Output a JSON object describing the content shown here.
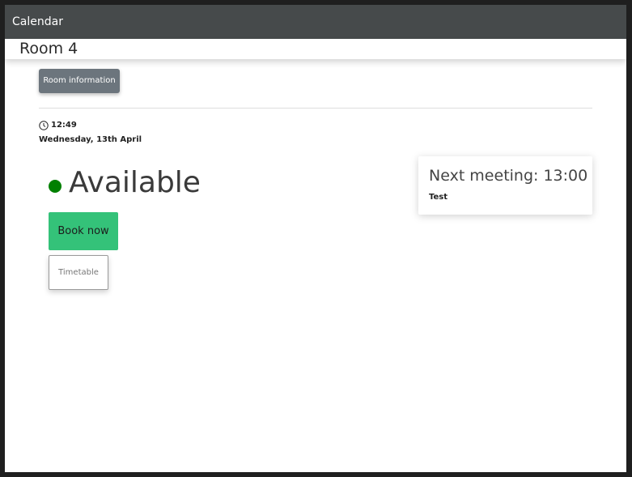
{
  "colors": {
    "available": "#008000",
    "book_button": "#34c279"
  },
  "topbar": {
    "title": "Calendar"
  },
  "room": {
    "title": "Room 4",
    "info_button": "Room information"
  },
  "clock": {
    "icon": "clock-icon",
    "time": "12:49",
    "date": "Wednesday, 13th April"
  },
  "status": {
    "label": "Available"
  },
  "actions": {
    "book_label": "Book now",
    "timetable_label": "Timetable"
  },
  "next_meeting": {
    "label": "Next meeting: 13:00",
    "name": "Test"
  }
}
